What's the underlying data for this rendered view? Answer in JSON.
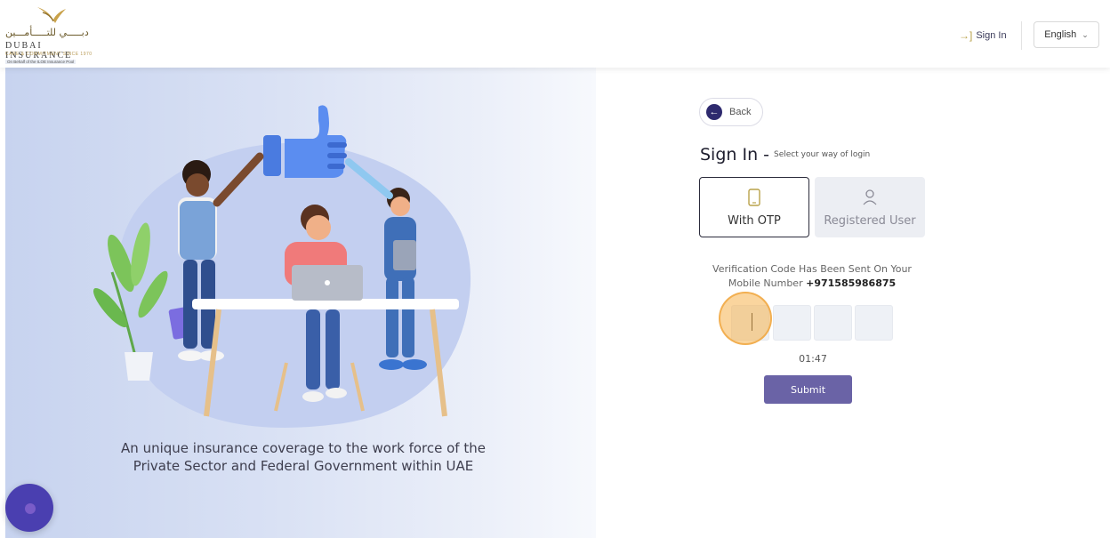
{
  "header": {
    "logo": {
      "arabic": "دبـــــي للتـــــأمـــين",
      "name": "DUBAI INSURANCE",
      "tagline": "CARE & COMMITMENT SINCE 1970",
      "behalf": "On Behalf of the ILOE Insurance Pool"
    },
    "sign_in_label": "Sign In",
    "language": "English"
  },
  "left": {
    "tagline": "An unique insurance coverage to the work force of the Private Sector and Federal Government within UAE"
  },
  "form": {
    "back_label": "Back",
    "title": "Sign In -",
    "subtitle": "Select your way of login",
    "options": [
      {
        "label": "With OTP",
        "icon": "mobile-phone-icon",
        "selected": true
      },
      {
        "label": "Registered User",
        "icon": "user-icon",
        "selected": false
      }
    ],
    "verify_text": "Verification Code Has Been Sent On Your Mobile Number",
    "phone": "+971585986875",
    "otp_values": [
      "",
      "",
      "",
      ""
    ],
    "timer": "01:47",
    "submit_label": "Submit"
  },
  "colors": {
    "brand_dark": "#2e2a6e",
    "submit": "#6a63a6",
    "gold": "#b9a24a",
    "highlight": "#f6b24e"
  }
}
